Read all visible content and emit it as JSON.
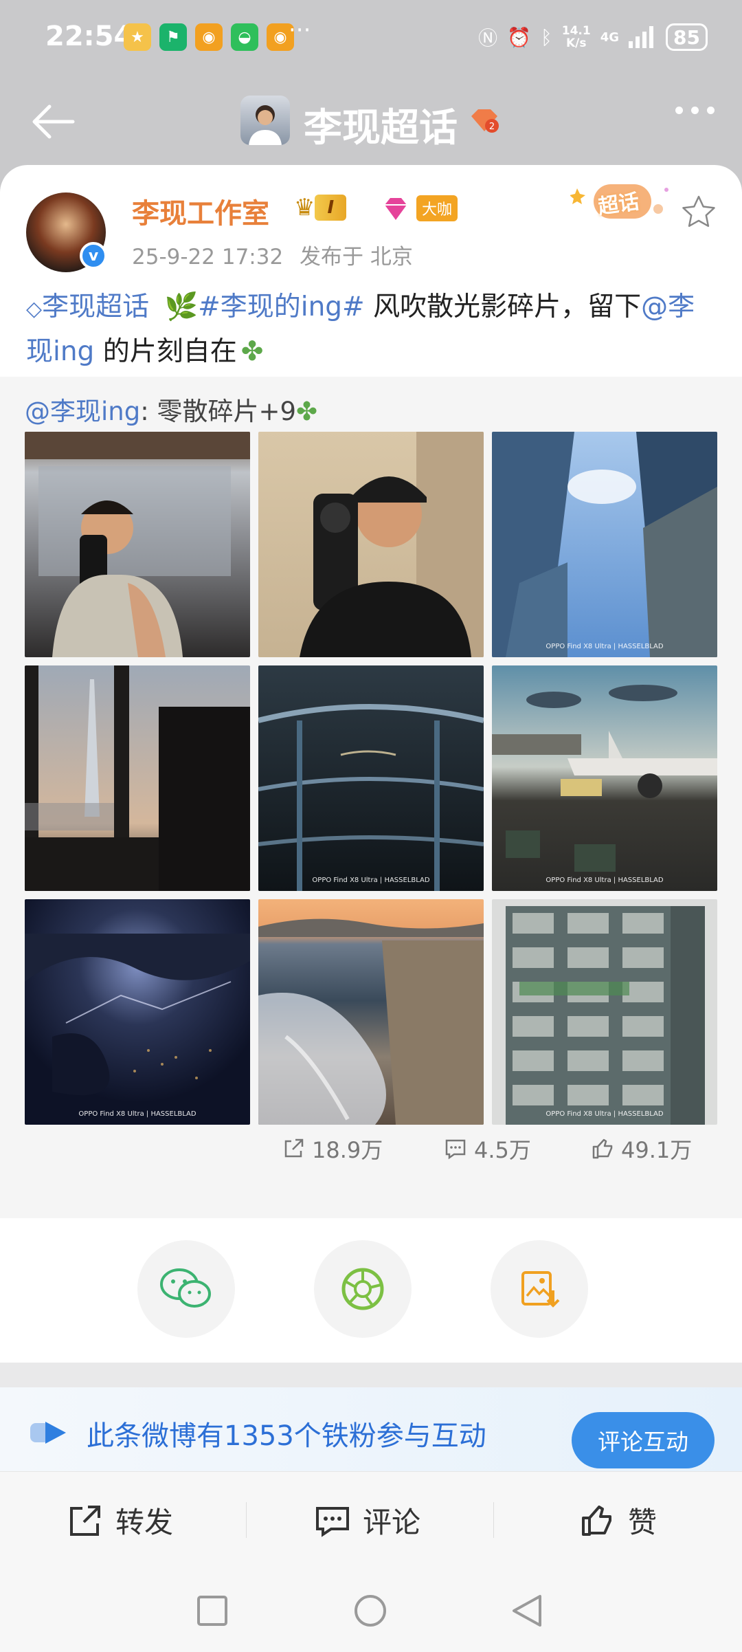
{
  "status": {
    "time": "22:54",
    "net_speed": "14.1",
    "net_unit": "K/s",
    "net_type": "4G",
    "battery": "85",
    "more": "···"
  },
  "header": {
    "title": "李现超话"
  },
  "post": {
    "author": "李现工作室",
    "level": "I",
    "big_v": "大咖",
    "time": "25-9-22 17:32",
    "location": "发布于 北京",
    "super_label": "超话",
    "text": {
      "topic": "李现超话",
      "hashtag": "#李现的ing#",
      "body1": " 风吹散光影碎片，留下",
      "mention": "@李现ing",
      "body2": " 的片刻自在"
    }
  },
  "repost": {
    "author": "@李现ing",
    "text": ": 零散碎片+9",
    "watermark": "OPPO Find X8 Ultra | HASSELBLAD"
  },
  "stats": {
    "reposts": "18.9万",
    "comments": "4.5万",
    "likes": "49.1万"
  },
  "promo": {
    "text": "此条微博有1353个铁粉参与互动",
    "button": "评论互动"
  },
  "actions": {
    "repost": "转发",
    "comment": "评论",
    "like": "赞"
  },
  "colors": {
    "accent": "#e8803a",
    "link": "#4f7ac7",
    "promo_blue": "#3a8fe8"
  }
}
